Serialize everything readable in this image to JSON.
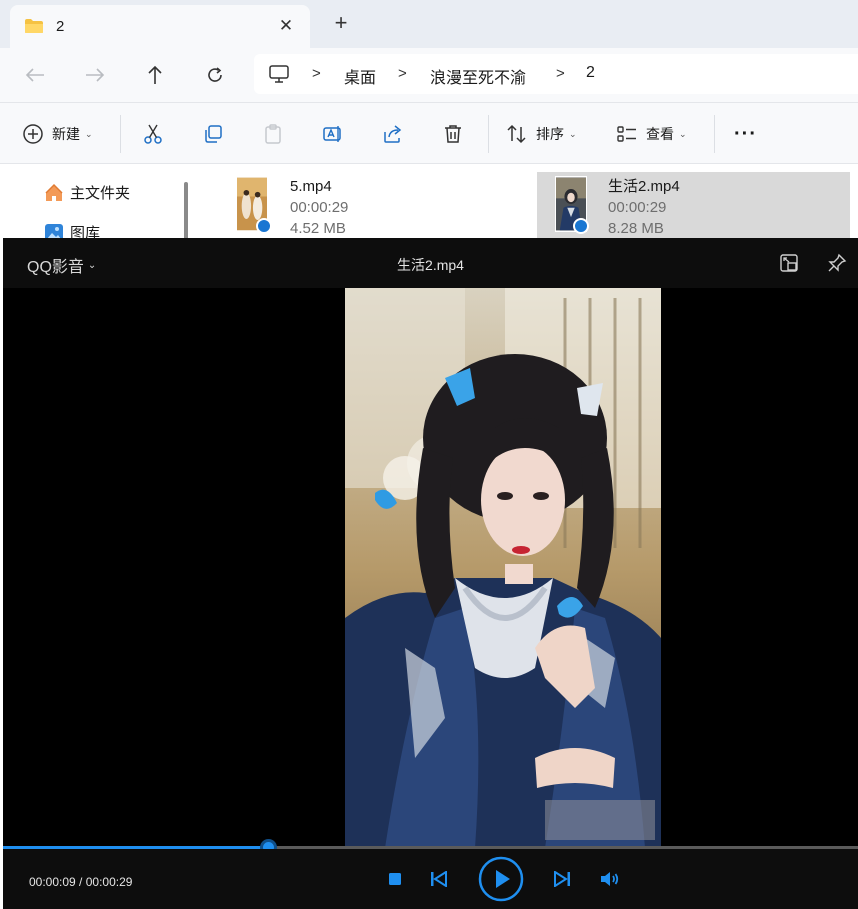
{
  "explorer": {
    "tab_title": "2",
    "breadcrumb": [
      "桌面",
      "浪漫至死不渝",
      "2"
    ],
    "toolbar": {
      "new_label": "新建",
      "sort_label": "排序",
      "view_label": "查看",
      "more_label": "···"
    },
    "sidebar": [
      {
        "label": "主文件夹",
        "icon": "home-icon"
      },
      {
        "label": "图库",
        "icon": "gallery-icon"
      }
    ],
    "files": [
      {
        "name": "5.mp4",
        "duration": "00:00:29",
        "size": "4.52 MB",
        "selected": false
      },
      {
        "name": "生活2.mp4",
        "duration": "00:00:29",
        "size": "8.28 MB",
        "selected": true
      }
    ]
  },
  "player": {
    "brand": "QQ影音",
    "title": "生活2.mp4",
    "current_time": "00:00:09",
    "total_time": "00:00:29",
    "time_separator": " / ",
    "progress_fraction": 0.31,
    "accent_color": "#1f8ff0"
  }
}
